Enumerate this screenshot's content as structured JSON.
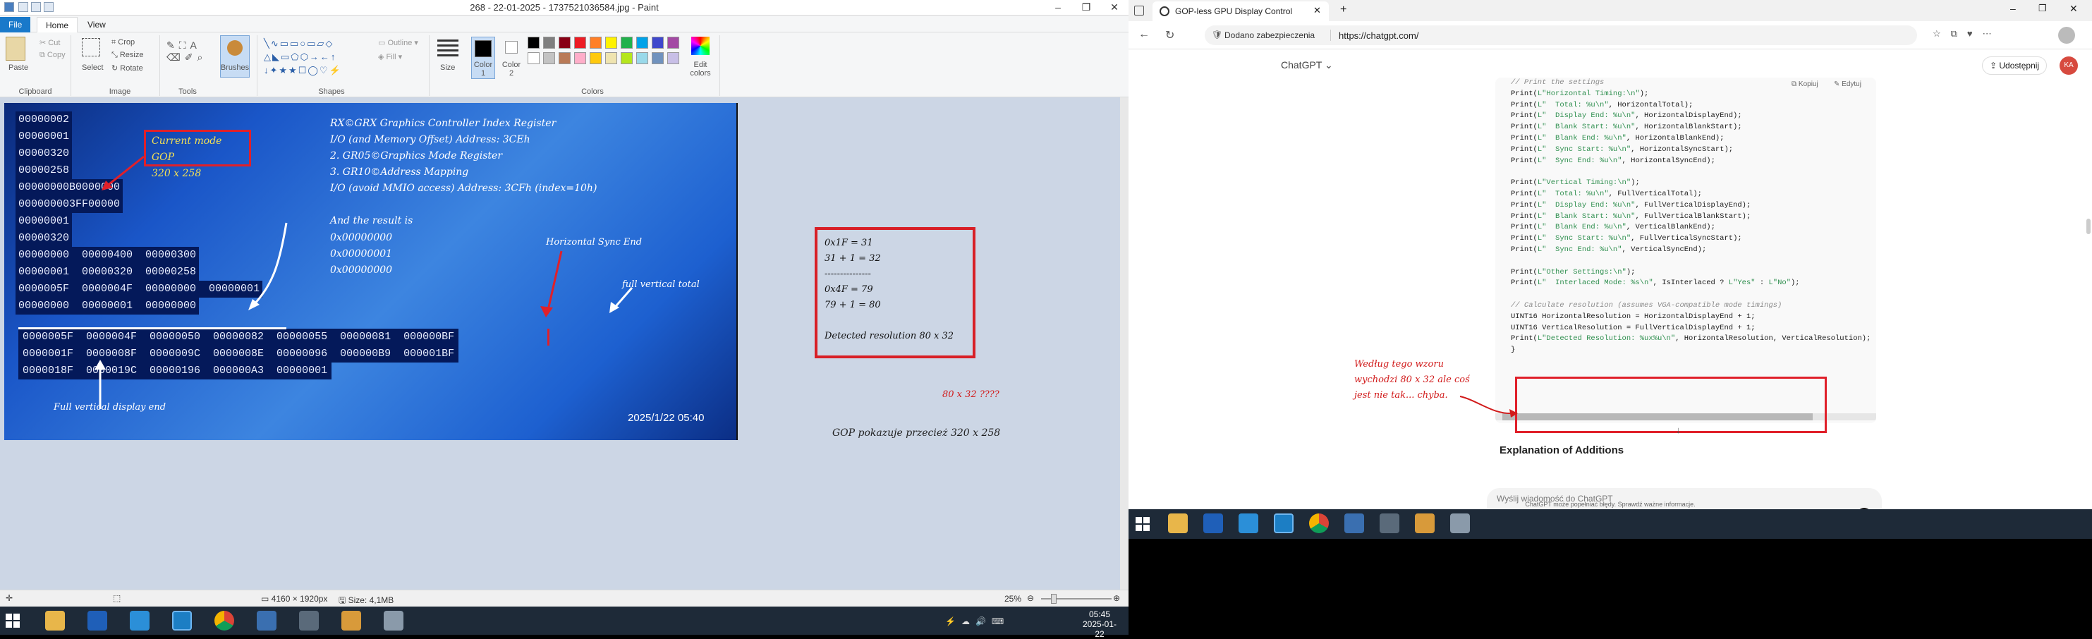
{
  "paint": {
    "title": "268 - 22-01-2025 - 1737521036584.jpg - Paint",
    "tabs": [
      "File",
      "Home",
      "View"
    ],
    "clipboard": {
      "paste": "Paste",
      "cut": "Cut",
      "copy": "Copy",
      "group": "Clipboard"
    },
    "image": {
      "select": "Select",
      "crop": "Crop",
      "resize": "Resize",
      "rotate": "Rotate",
      "group": "Image"
    },
    "tools": {
      "group": "Tools"
    },
    "brushes": "Brushes",
    "shapes": {
      "outline": "Outline",
      "fill": "Fill",
      "group": "Shapes"
    },
    "size": "Size",
    "color1": "Color\n1",
    "color2": "Color\n2",
    "colors_group": "Colors",
    "edit_colors": "Edit\ncolors",
    "palette": [
      "#000000",
      "#7f7f7f",
      "#880015",
      "#ed1c24",
      "#ff7f27",
      "#fff200",
      "#22b14c",
      "#00a2e8",
      "#3f48cc",
      "#a349a4",
      "#ffffff",
      "#c3c3c3",
      "#b97a57",
      "#ffaec9",
      "#ffc90e",
      "#efe4b0",
      "#b5e61d",
      "#99d9ea",
      "#7092be",
      "#c8bfe7"
    ],
    "photo": {
      "hex_lines": [
        "00000002",
        "00000001",
        "00000320",
        "00000258",
        "00000000B0000000",
        "000000003FF00000",
        "00000001",
        "00000320",
        "00000000  00000400  00000300",
        "00000001  00000320  00000258",
        "0000005F  0000004F  00000000  00000001",
        "00000000  00000001  00000000"
      ],
      "hex_row_a": "0000005F  0000004F  00000050  00000082  00000055  00000081  000000BF",
      "hex_row_b": "0000001F  0000008F  0000009C  0000008E  00000096  000000B9  000001BF",
      "hex_row_c": "0000018F  0000019C  00000196  000000A3  00000001",
      "gop_label": "Current mode GOP",
      "gop_value": "320 x 258",
      "notes": [
        "RX©GRX Graphics Controller Index Register",
        "I/O (and Memory Offset) Address: 3CEh",
        "2. GR05©Graphics Mode Register",
        "3. GR10©Address Mapping",
        "I/O (avoid MMIO access) Address: 3CFh (index=10h)"
      ],
      "result_title": "And the result is",
      "result_values": [
        "0x00000000",
        "0x00000001",
        "0x00000000"
      ],
      "hsync_label": "Horizontal Sync End",
      "fvt_label": "full vertical total",
      "fvde_label": "Full vertical display end",
      "timestamp": "2025/1/22 05:40"
    },
    "panel_lines": [
      "0x1F = 31",
      "31 + 1 = 32",
      "---------------",
      "0x4F = 79",
      "79 + 1 = 80",
      "",
      "Detected resolution 80 x 32"
    ],
    "question": "80 x 32 ????",
    "gop_note": "GOP pokazuje przecież 320 x 258",
    "status": {
      "dims": "4160 × 1920px",
      "size": "Size: 4,1MB",
      "zoom": "25%"
    }
  },
  "left_taskbar": {
    "time": "05:45",
    "date": "2025-01-22"
  },
  "edge": {
    "tab_title": "GOP-less GPU Display Control",
    "secure": "Dodano zabezpieczenia",
    "url": "https://chatgpt.com/",
    "model": "ChatGPT",
    "share": "Udostępnij",
    "avatar": "KA",
    "copy": "Kopiuj",
    "edit": "Edytuj",
    "code_lines": [
      {
        "t": "// Print the settings",
        "c": "cm"
      },
      {
        "t": "Print(L\"Horizontal Timing:\\n\");",
        "c": ""
      },
      {
        "t": "Print(L\"  Total: %u\\n\", HorizontalTotal);",
        "c": ""
      },
      {
        "t": "Print(L\"  Display End: %u\\n\", HorizontalDisplayEnd);",
        "c": ""
      },
      {
        "t": "Print(L\"  Blank Start: %u\\n\", HorizontalBlankStart);",
        "c": ""
      },
      {
        "t": "Print(L\"  Blank End: %u\\n\", HorizontalBlankEnd);",
        "c": ""
      },
      {
        "t": "Print(L\"  Sync Start: %u\\n\", HorizontalSyncStart);",
        "c": ""
      },
      {
        "t": "Print(L\"  Sync End: %u\\n\", HorizontalSyncEnd);",
        "c": ""
      },
      {
        "t": "",
        "c": ""
      },
      {
        "t": "Print(L\"Vertical Timing:\\n\");",
        "c": ""
      },
      {
        "t": "Print(L\"  Total: %u\\n\", FullVerticalTotal);",
        "c": ""
      },
      {
        "t": "Print(L\"  Display End: %u\\n\", FullVerticalDisplayEnd);",
        "c": ""
      },
      {
        "t": "Print(L\"  Blank Start: %u\\n\", FullVerticalBlankStart);",
        "c": ""
      },
      {
        "t": "Print(L\"  Blank End: %u\\n\", VerticalBlankEnd);",
        "c": ""
      },
      {
        "t": "Print(L\"  Sync Start: %u\\n\", FullVerticalSyncStart);",
        "c": ""
      },
      {
        "t": "Print(L\"  Sync End: %u\\n\", VerticalSyncEnd);",
        "c": ""
      },
      {
        "t": "",
        "c": ""
      },
      {
        "t": "Print(L\"Other Settings:\\n\");",
        "c": ""
      },
      {
        "t": "Print(L\"  Interlaced Mode: %s\\n\", IsInterlaced ? L\"Yes\" : L\"No\");",
        "c": ""
      },
      {
        "t": "",
        "c": ""
      },
      {
        "t": "// Calculate resolution (assumes VGA-compatible mode timings)",
        "c": "cm"
      },
      {
        "t": "UINT16 HorizontalResolution = HorizontalDisplayEnd + 1;",
        "c": ""
      },
      {
        "t": "UINT16 VerticalResolution = FullVerticalDisplayEnd + 1;",
        "c": ""
      },
      {
        "t": "Print(L\"Detected Resolution: %ux%u\\n\", HorizontalResolution, VerticalResolution);",
        "c": ""
      },
      {
        "t": "}",
        "c": ""
      }
    ],
    "note": "Według tego wzoru wychodzi 80 x 32 ale coś jest nie tak... chyba.",
    "heading": "Explanation of Additions",
    "placeholder": "Wyślij wiadomość do ChatGPT",
    "disclaimer": "ChatGPT może popełniać błędy. Sprawdź ważne informacje."
  }
}
